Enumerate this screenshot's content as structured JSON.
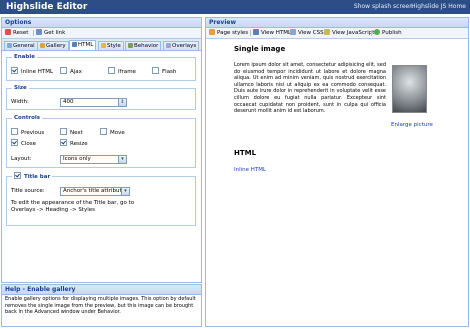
{
  "app": {
    "title": "Highslide Editor",
    "links": [
      "Show splash screen",
      "Highslide JS Home"
    ]
  },
  "options_panel": {
    "title": "Options",
    "toolbar": {
      "reset": "Reset",
      "get_link": "Get link"
    },
    "tabs": [
      "General",
      "Gallery",
      "HTML",
      "Style",
      "Behavior",
      "Overlays"
    ],
    "active_tab": "HTML",
    "enable": {
      "legend": "Enable",
      "items": [
        {
          "label": "Inline HTML",
          "checked": true
        },
        {
          "label": "Ajax",
          "checked": false
        },
        {
          "label": "Iframe",
          "checked": false
        },
        {
          "label": "Flash",
          "checked": false
        }
      ]
    },
    "size": {
      "legend": "Size",
      "width_label": "Width:",
      "width_value": "400"
    },
    "controls": {
      "legend": "Controls",
      "items": [
        {
          "label": "Previous",
          "checked": false
        },
        {
          "label": "Next",
          "checked": false
        },
        {
          "label": "Move",
          "checked": false
        },
        {
          "label": "Close",
          "checked": true
        },
        {
          "label": "Resize",
          "checked": true
        }
      ],
      "layout_label": "Layout:",
      "layout_value": "Icons only"
    },
    "title_bar": {
      "legend": "Title bar",
      "checked": true,
      "source_label": "Title source:",
      "source_value": "Anchor's title attribute",
      "note_line1": "To edit the appearance of the Title bar, go to",
      "note_line2": "Overlays -> Heading -> Styles"
    }
  },
  "help_panel": {
    "title": "Help - Enable gallery",
    "text": "Enable gallery options for displaying multiple images. This option by default removes the single image from the preview, but this image can be brought back in the Advanced window under Behavior."
  },
  "preview_panel": {
    "title": "Preview",
    "toolbar": [
      "Page styles",
      "View HTML",
      "View CSS",
      "View JavaScript",
      "Publish"
    ],
    "heading": "Single image",
    "body": "Lorem ipsum dolor sit amet, consectetur adipisicing elit, sed do eiusmod tempor incididunt ut labore et dolore magna aliqua. Ut enim ad minim veniam, quis nostrud exercitation ullamco laboris nisi ut aliquip ex ea commodo consequat. Duis aute irure dolor in reprehenderit in voluptate velit esse cillum dolore eu fugiat nulla pariatur. Excepteur sint occaecat cupidatat non proident, sunt in culpa qui officia deserunt mollit anim id est laborum.",
    "image_caption": "Enlarge picture",
    "html_heading": "HTML",
    "html_link": "Inline HTML"
  },
  "colors": {
    "header_bg": "#2d4d86",
    "panel_title": "#15428b",
    "link": "#1a3fb0"
  }
}
